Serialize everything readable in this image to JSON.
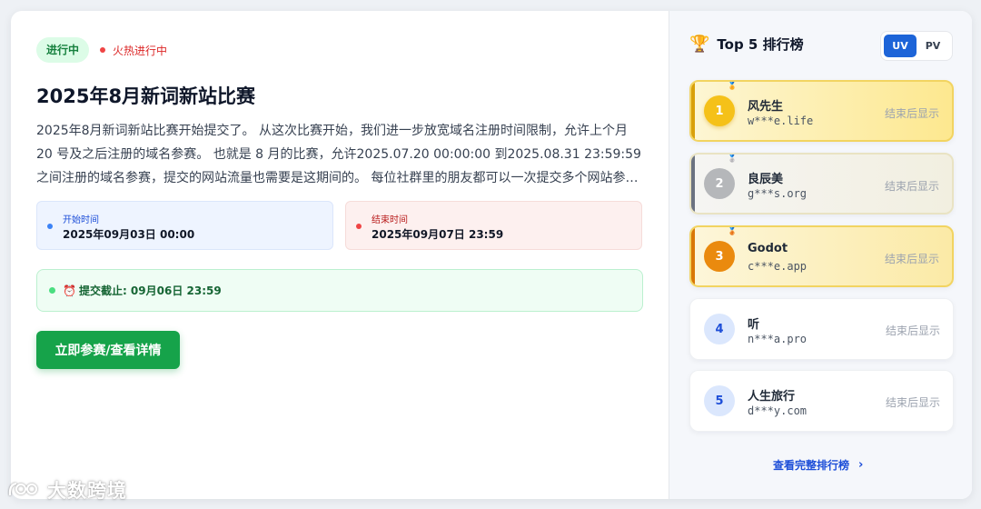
{
  "contest": {
    "status_badge": "进行中",
    "hot_label": "火热进行中",
    "title": "2025年8月新词新站比赛",
    "description": "2025年8月新词新站比赛开始提交了。 从这次比赛开始，我们进一步放宽域名注册时间限制，允许上个月 20 号及之后注册的域名参赛。 也就是 8 月的比赛，允许2025.07.20 00:00:00 到2025.08.31 23:59:59 之间注册的域名参赛，提交的网站流量也需要是这期间的。 每位社群里的朋友都可以一次提交多个网站参赛，但...",
    "start_label": "开始时间",
    "start_value": "2025年09月03日 00:00",
    "end_label": "结束时间",
    "end_value": "2025年09月07日 23:59",
    "deadline_text": "提交截止: 09月06日 23:59",
    "deadline_icon": "alarm-clock-icon",
    "join_button": "立即参赛/查看详情"
  },
  "watermark": {
    "text": "大数跨境"
  },
  "ranking": {
    "title": "Top 5 排行榜",
    "title_icon": "trophy-icon",
    "toggle": {
      "uv": "UV",
      "pv": "PV",
      "active": "UV"
    },
    "items": [
      {
        "rank": "1",
        "name": "风先生",
        "domain": "w***e.life",
        "value": "结束后显示"
      },
      {
        "rank": "2",
        "name": "良辰美",
        "domain": "g***s.org",
        "value": "结束后显示"
      },
      {
        "rank": "3",
        "name": "Godot",
        "domain": "c***e.app",
        "value": "结束后显示"
      },
      {
        "rank": "4",
        "name": "听",
        "domain": "n***a.pro",
        "value": "结束后显示"
      },
      {
        "rank": "5",
        "name": "人生旅行",
        "domain": "d***y.com",
        "value": "结束后显示"
      }
    ],
    "full_link": "查看完整排行榜"
  },
  "colors": {
    "primary_green": "#16a34a",
    "accent_blue": "#1d64d8",
    "gold": "#f5c119",
    "silver": "#b5b7ba",
    "bronze": "#ea8a0e"
  }
}
